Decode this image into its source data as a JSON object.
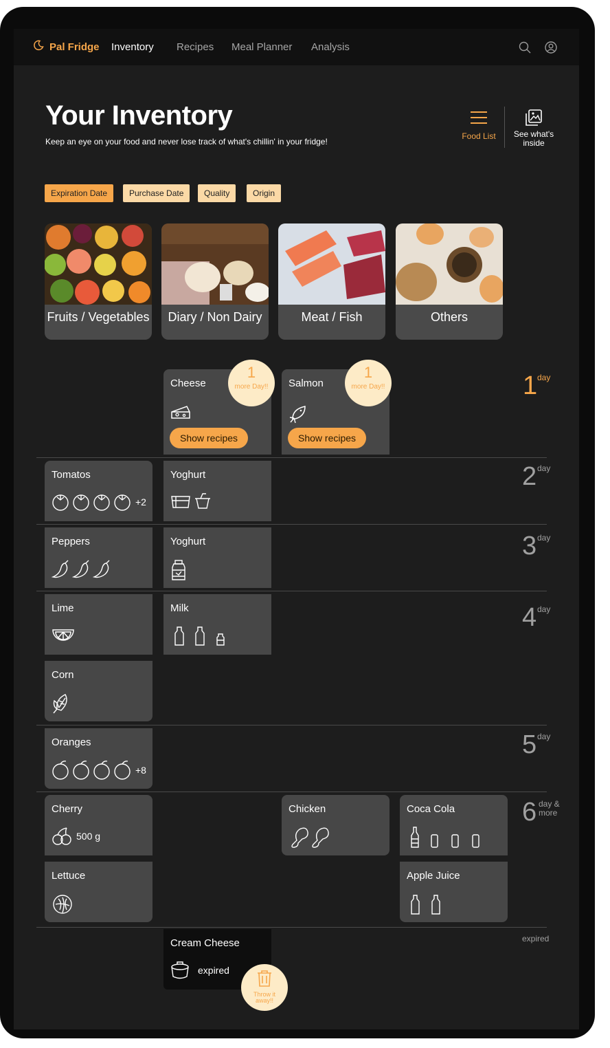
{
  "nav": {
    "brand": "Pal Fridge",
    "links": [
      "Inventory",
      "Recipes",
      "Meal Planner",
      "Analysis"
    ],
    "active": "Inventory"
  },
  "header": {
    "title": "Your Inventory",
    "subtitle": "Keep an eye on your food and never lose track of what's chillin' in your fridge!",
    "food_list_label": "Food List",
    "see_inside_label": "See what's inside"
  },
  "filters": [
    "Expiration Date",
    "Purchase Date",
    "Quality",
    "Origin"
  ],
  "active_filter": "Expiration Date",
  "categories": [
    "Fruits / Vegetables",
    "Diary / Non Dairy",
    "Meat / Fish",
    "Others"
  ],
  "days": [
    {
      "n": "1",
      "tag": "day"
    },
    {
      "n": "2",
      "tag": "day"
    },
    {
      "n": "3",
      "tag": "day"
    },
    {
      "n": "4",
      "tag": "day"
    },
    {
      "n": "5",
      "tag": "day"
    },
    {
      "n": "6",
      "tag": "day & more"
    }
  ],
  "expired_label": "expired",
  "items": {
    "cheese": {
      "name": "Cheese",
      "badge_n": "1",
      "badge_t": "more Day!!",
      "button": "Show recipes"
    },
    "salmon": {
      "name": "Salmon",
      "badge_n": "1",
      "badge_t": "more Day!!",
      "button": "Show recipes"
    },
    "tomatos": {
      "name": "Tomatos",
      "extra": "+2"
    },
    "yoghurt_2": {
      "name": "Yoghurt"
    },
    "peppers": {
      "name": "Peppers"
    },
    "yoghurt_3": {
      "name": "Yoghurt"
    },
    "lime": {
      "name": "Lime"
    },
    "milk": {
      "name": "Milk"
    },
    "corn": {
      "name": "Corn"
    },
    "oranges": {
      "name": "Oranges",
      "extra": "+8"
    },
    "cherry": {
      "name": "Cherry",
      "qty": "500 g"
    },
    "chicken": {
      "name": "Chicken"
    },
    "coca_cola": {
      "name": "Coca Cola"
    },
    "lettuce": {
      "name": "Lettuce"
    },
    "apple_juice": {
      "name": "Apple Juice"
    },
    "cream_cheese": {
      "name": "Cream Cheese",
      "status": "expired",
      "action": "Throw it away!!"
    }
  },
  "colors": {
    "accent": "#f6a64a",
    "accent_light": "#fdebc7",
    "card": "#474747",
    "background": "#1d1d1d"
  }
}
